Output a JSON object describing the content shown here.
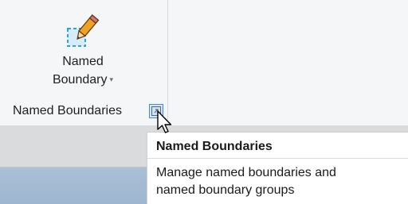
{
  "ribbon": {
    "button": {
      "label_line1": "Named",
      "label_line2": "Boundary",
      "dropdown_glyph": "▾",
      "icon": "pencil-dashed-square-icon"
    },
    "panel_title": "Named Boundaries",
    "dialog_launcher_icon": "dialog-launcher-icon"
  },
  "tooltip": {
    "title": "Named Boundaries",
    "description_line1": "Manage named boundaries and",
    "description_line2": "named boundary groups"
  },
  "colors": {
    "ribbon_bg": "#f5f6f7",
    "band_bg": "#dadbdc",
    "bottom_strip": "#a9bfd6",
    "launcher_border": "#3d8fd1",
    "icon_dash": "#2e9fe0",
    "pencil_body": "#f0a223"
  }
}
